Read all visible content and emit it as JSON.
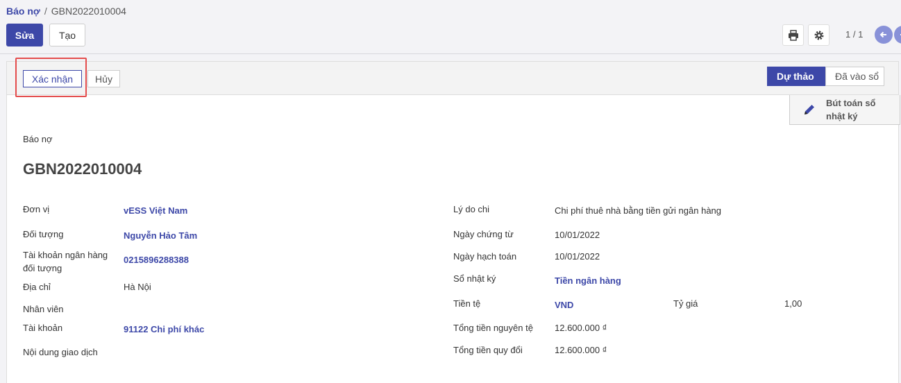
{
  "breadcrumb": {
    "parent": "Báo nợ",
    "separator": "/",
    "current": "GBN2022010004"
  },
  "toolbar": {
    "edit_label": "Sửa",
    "create_label": "Tạo",
    "pager": "1 / 1"
  },
  "statusbar": {
    "confirm_label": "Xác nhận",
    "cancel_label": "Hủy",
    "stages": [
      "Dự thảo",
      "Đã vào sổ"
    ],
    "active_stage": "Dự thảo"
  },
  "smart_button": {
    "label": "Bút toán sổ nhật ký"
  },
  "document": {
    "type": "Báo nợ",
    "name": "GBN2022010004"
  },
  "fields_left": {
    "don_vi": {
      "label": "Đơn vị",
      "value": "vESS Việt Nam"
    },
    "doi_tuong": {
      "label": "Đối tượng",
      "value": "Nguyễn Hảo Tâm"
    },
    "tk_ngan_hang": {
      "label": "Tài khoản ngân hàng đối tượng",
      "value": "0215896288388"
    },
    "dia_chi": {
      "label": "Địa chỉ",
      "value": "Hà Nội"
    },
    "nhan_vien": {
      "label": "Nhân viên",
      "value": ""
    },
    "tai_khoan": {
      "label": "Tài khoản",
      "value": "91122 Chi phí khác"
    },
    "noi_dung": {
      "label": "Nội dung giao dịch",
      "value": ""
    }
  },
  "fields_right": {
    "ly_do": {
      "label": "Lý do chi",
      "value": "Chi phí thuê nhà bằng tiền gửi ngân hàng"
    },
    "ngay_chung_tu": {
      "label": "Ngày chứng từ",
      "value": "10/01/2022"
    },
    "ngay_hach_toan": {
      "label": "Ngày hạch toán",
      "value": "10/01/2022"
    },
    "so_nhat_ky": {
      "label": "Sổ nhật ký",
      "value": "Tiền ngân hàng"
    },
    "tien_te": {
      "label": "Tiền tệ",
      "value": "VND"
    },
    "ty_gia": {
      "label": "Tỷ giá",
      "value": "1,00"
    },
    "tong_nguyen_te": {
      "label": "Tổng tiền nguyên tệ",
      "value": "12.600.000 ₫"
    },
    "tong_quy_doi": {
      "label": "Tổng tiền quy đổi",
      "value": "12.600.000 ₫"
    }
  },
  "colors": {
    "primary": "#3d48a8",
    "highlight": "#e44c4c",
    "nav": "#8891d8"
  }
}
